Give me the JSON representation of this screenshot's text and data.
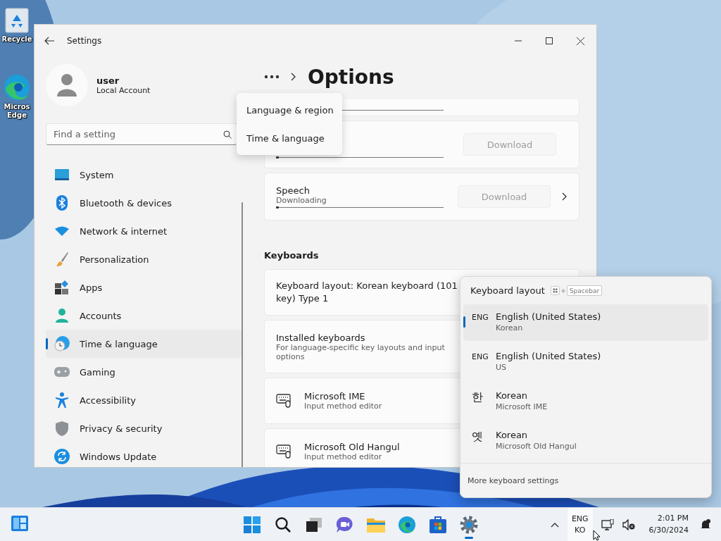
{
  "desktop": {
    "icons": [
      {
        "kind": "recycle",
        "label": "Recycle"
      },
      {
        "kind": "edge",
        "label": "Micros Edge"
      }
    ]
  },
  "window": {
    "title": "Settings"
  },
  "account": {
    "name": "user",
    "type": "Local Account"
  },
  "search": {
    "placeholder": "Find a setting"
  },
  "nav": [
    {
      "kind": "system",
      "label": "System",
      "selected": false
    },
    {
      "kind": "bluetooth",
      "label": "Bluetooth & devices",
      "selected": false
    },
    {
      "kind": "network",
      "label": "Network & internet",
      "selected": false
    },
    {
      "kind": "personalization",
      "label": "Personalization",
      "selected": false
    },
    {
      "kind": "apps",
      "label": "Apps",
      "selected": false
    },
    {
      "kind": "accounts",
      "label": "Accounts",
      "selected": false
    },
    {
      "kind": "time",
      "label": "Time & language",
      "selected": true
    },
    {
      "kind": "gaming",
      "label": "Gaming",
      "selected": false
    },
    {
      "kind": "accessibility",
      "label": "Accessibility",
      "selected": false
    },
    {
      "kind": "privacy",
      "label": "Privacy & security",
      "selected": false
    },
    {
      "kind": "update",
      "label": "Windows Update",
      "selected": false
    }
  ],
  "breadcrumb": {
    "current": "Options"
  },
  "breadcrumb_menu": [
    "Language & region",
    "Time & language"
  ],
  "features": [
    {
      "button": "Download",
      "disabled": true,
      "level": 0.01,
      "chevron": false
    },
    {
      "title": "Speech",
      "status": "Downloading",
      "button": "Download",
      "disabled": true,
      "level": 0.01,
      "chevron": true
    }
  ],
  "keyboards": {
    "heading": "Keyboards",
    "layout": "Keyboard layout: Korean keyboard (101 key) Type 1",
    "installed": {
      "title": "Installed keyboards",
      "description": "For language-specific key layouts and input options"
    },
    "items": [
      {
        "name": "Microsoft IME",
        "description": "Input method editor"
      },
      {
        "name": "Microsoft Old Hangul",
        "description": "Input method editor"
      }
    ]
  },
  "layout_flyout": {
    "title": "Keyboard layout",
    "shortcut_key": "Spacebar",
    "options": [
      {
        "code": "ENG",
        "name": "English (United States)",
        "layout": "Korean",
        "selected": true
      },
      {
        "code": "ENG",
        "name": "English (United States)",
        "layout": "US",
        "selected": false
      },
      {
        "code": "한",
        "name": "Korean",
        "layout": "Microsoft IME",
        "selected": false
      },
      {
        "code": "옛",
        "name": "Korean",
        "layout": "Microsoft Old Hangul",
        "selected": false
      }
    ],
    "footer": "More keyboard settings"
  },
  "taskbar": {
    "apps": [
      {
        "kind": "start",
        "active": false
      },
      {
        "kind": "search",
        "active": false
      },
      {
        "kind": "taskview",
        "active": false
      },
      {
        "kind": "chat",
        "active": false
      },
      {
        "kind": "explorer",
        "active": false
      },
      {
        "kind": "edge",
        "active": false
      },
      {
        "kind": "store",
        "active": false
      },
      {
        "kind": "settings",
        "active": true
      }
    ],
    "input_indicator": [
      "ENG",
      "KO"
    ],
    "time": "2:01 PM",
    "date": "6/30/2024"
  }
}
